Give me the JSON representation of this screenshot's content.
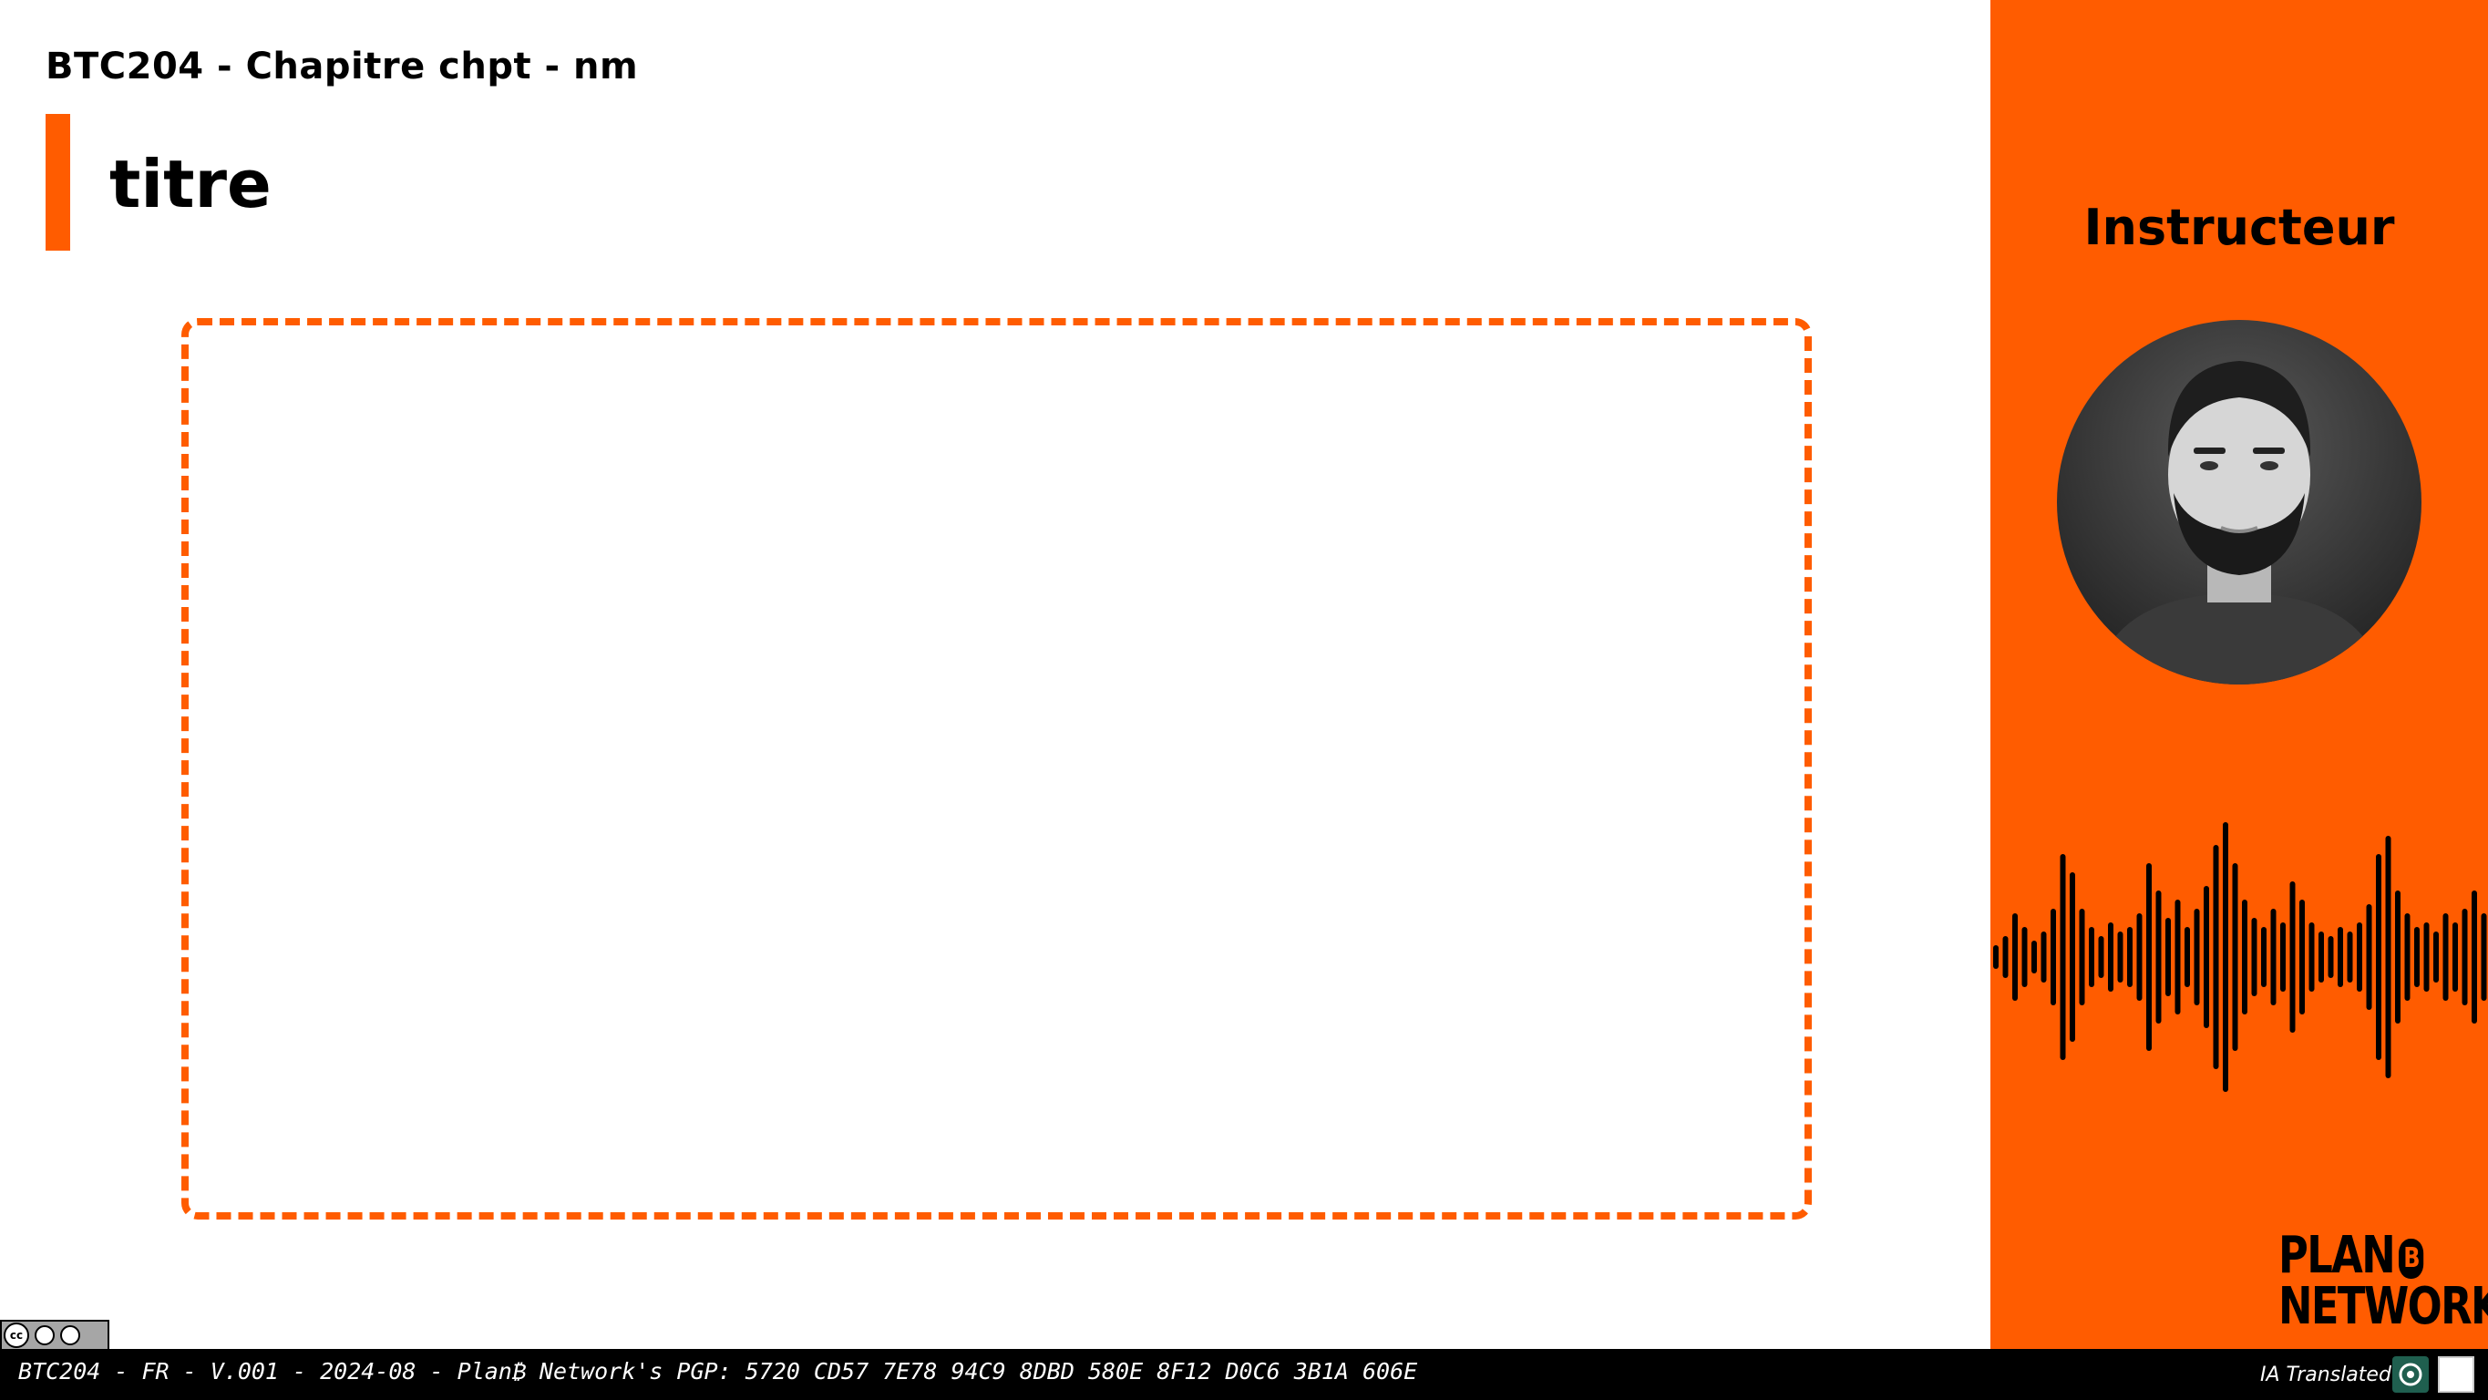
{
  "slide": {
    "header": "BTC204 - Chapitre chpt - nm",
    "title": "titre",
    "accent_color": "#ff5c00"
  },
  "sidebar": {
    "instructor_label": "Instructeur",
    "avatar_icon": "instructor-photo",
    "waveform_icon": "audio-waveform-icon"
  },
  "brand": {
    "line1": "PLAN",
    "badge": "B",
    "line2": "NETWORK"
  },
  "license": {
    "cc": "cc",
    "by": "BY",
    "sa": "SA"
  },
  "footer": {
    "text": "BTC204 - FR - V.001 - 2024-08 - Plan₿ Network's PGP: 5720 CD57 7E78 94C9 8DBD 580E 8F12 D0C6 3B1A 606E",
    "translated": "IA Translated"
  }
}
